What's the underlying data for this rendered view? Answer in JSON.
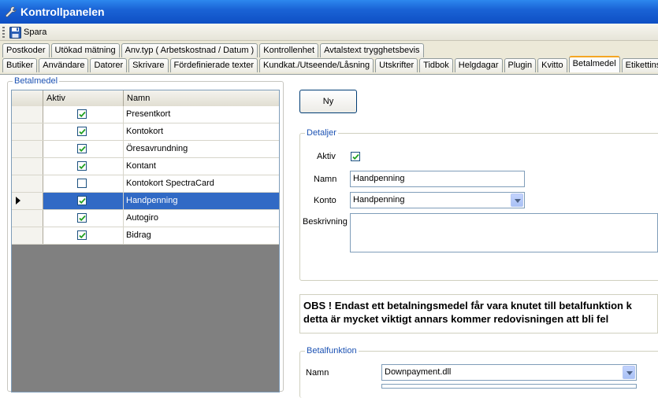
{
  "window": {
    "title": "Kontrollpanelen"
  },
  "toolbar": {
    "save_label": "Spara"
  },
  "tabs_row1": [
    "Postkoder",
    "Utökad mätning",
    "Anv.typ ( Arbetskostnad / Datum )",
    "Kontrollenhet",
    "Avtalstext trygghetsbevis"
  ],
  "tabs_row2": [
    "Butiker",
    "Användare",
    "Datorer",
    "Skrivare",
    "Fördefinierade texter",
    "Kundkat./Utseende/Låsning",
    "Utskrifter",
    "Tidbok",
    "Helgdagar",
    "Plugin",
    "Kvitto",
    "Betalmedel",
    "Etikettinställ"
  ],
  "active_tab": "Betalmedel",
  "betalmedel": {
    "group_label": "Betalmedel",
    "columns": [
      "Aktiv",
      "Namn"
    ],
    "rows": [
      {
        "name": "Presentkort",
        "active": true,
        "selected": false
      },
      {
        "name": "Kontokort",
        "active": true,
        "selected": false
      },
      {
        "name": "Öresavrundning",
        "active": true,
        "selected": false
      },
      {
        "name": "Kontant",
        "active": true,
        "selected": false
      },
      {
        "name": "Kontokort SpectraCard",
        "active": false,
        "selected": false
      },
      {
        "name": "Handpenning",
        "active": true,
        "selected": true
      },
      {
        "name": "Autogiro",
        "active": true,
        "selected": false
      },
      {
        "name": "Bidrag",
        "active": true,
        "selected": false
      }
    ]
  },
  "new_button_label": "Ny",
  "detaljer": {
    "group_label": "Detaljer",
    "aktiv_label": "Aktiv",
    "aktiv_checked": true,
    "namn_label": "Namn",
    "namn_value": "Handpenning",
    "konto_label": "Konto",
    "konto_value": "Handpenning",
    "beskrivning_label": "Beskrivning",
    "beskrivning_value": ""
  },
  "obs_text": {
    "line1": "OBS ! Endast ett betalningsmedel får vara knutet till betalfunktion k",
    "line2": "detta är mycket viktigt annars kommer redovisningen att bli fel"
  },
  "betalfunktion": {
    "group_label": "Betalfunktion",
    "namn_label": "Namn",
    "namn_value": "Downpayment.dll"
  },
  "colors": {
    "title_bar": "#0e4fc4",
    "selection": "#316ac5",
    "active_tab_accent": "#f4a623",
    "group_label": "#1c52b3"
  }
}
